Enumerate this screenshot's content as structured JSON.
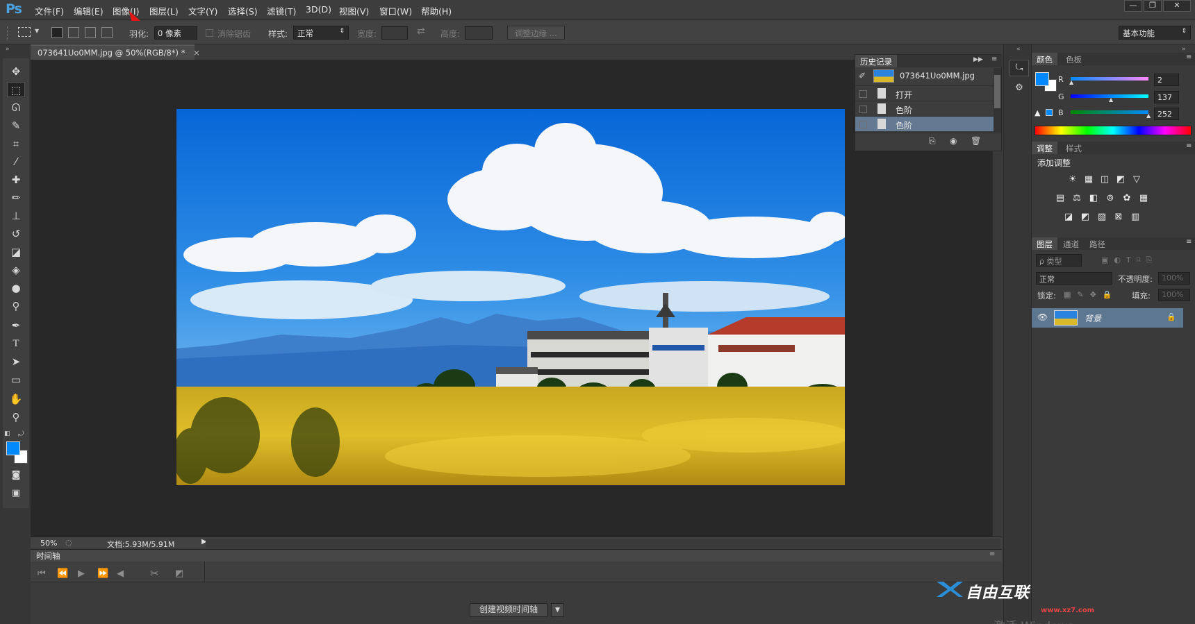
{
  "app": {
    "logo": "Ps"
  },
  "menu": [
    "文件(F)",
    "编辑(E)",
    "图像(I)",
    "图层(L)",
    "文字(Y)",
    "选择(S)",
    "滤镜(T)",
    "3D(D)",
    "视图(V)",
    "窗口(W)",
    "帮助(H)"
  ],
  "window_controls": {
    "minimize": "—",
    "restore": "❐",
    "close": "✕"
  },
  "options": {
    "feather_label": "羽化:",
    "feather_value": "0 像素",
    "antialias_label": "消除锯齿",
    "style_label": "样式:",
    "style_value": "正常",
    "width_label": "宽度:",
    "height_label": "高度:",
    "refine_edge": "调整边缘 ...",
    "workspace": "基本功能"
  },
  "document": {
    "tab_title": "073641Uo0MM.jpg @ 50%(RGB/8*) *",
    "zoom": "50%",
    "doc_size": "文档:5.93M/5.91M"
  },
  "history": {
    "tab_label": "历史记录",
    "snapshot_name": "073641Uo0MM.jpg",
    "items": [
      "打开",
      "色阶",
      "色阶"
    ],
    "selected_index": 2
  },
  "color_panel": {
    "tabs": [
      "颜色",
      "色板"
    ],
    "r_label": "R",
    "g_label": "G",
    "b_label": "B",
    "r": "2",
    "g": "137",
    "b": "252",
    "foreground": "#0289fc"
  },
  "adjustments": {
    "tabs": [
      "调整",
      "样式"
    ],
    "title": "添加调整",
    "icons": [
      "brightness-icon",
      "levels-icon",
      "curves-icon",
      "exposure-icon",
      "vibrance-icon",
      "hue-saturation-icon",
      "color-balance-icon",
      "black-white-icon",
      "photo-filter-icon",
      "channel-mixer-icon",
      "color-lookup-icon",
      "invert-icon",
      "posterize-icon",
      "threshold-icon",
      "selective-color-icon",
      "gradient-map-icon"
    ]
  },
  "layers": {
    "tabs": [
      "图层",
      "通道",
      "路径"
    ],
    "filter_label": "ρ 类型",
    "blend_mode": "正常",
    "opacity_label": "不透明度:",
    "opacity_value": "100%",
    "lock_label": "锁定:",
    "fill_label": "填充:",
    "fill_value": "100%",
    "layer_name": "背景"
  },
  "timeline": {
    "tab_label": "时间轴",
    "create_button": "创建视频时间轴"
  },
  "watermark": {
    "brand": "自由互联",
    "url": "www.xz7.com",
    "activate_text": "激活 Windows"
  }
}
